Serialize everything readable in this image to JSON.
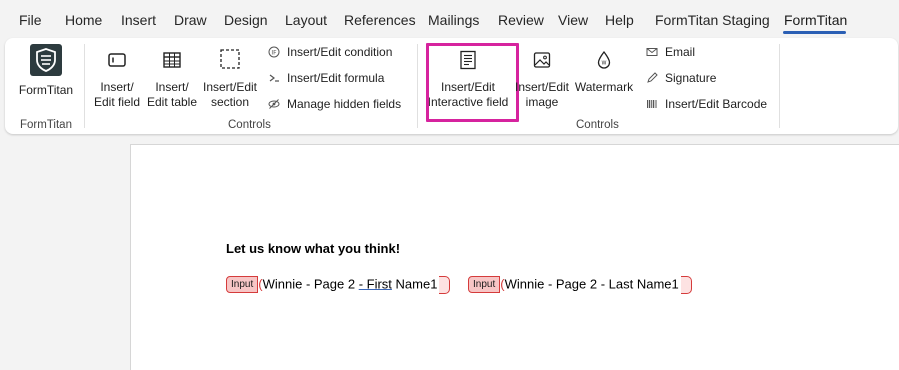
{
  "menu": {
    "items": [
      "File",
      "Home",
      "Insert",
      "Draw",
      "Design",
      "Layout",
      "References",
      "Mailings",
      "Review",
      "View",
      "Help",
      "FormTitan Staging",
      "FormTitan"
    ],
    "active": "FormTitan"
  },
  "ribbon": {
    "formtitan_group": {
      "button_label": "FormTitan",
      "group_label": "FormTitan"
    },
    "controls_group_1": {
      "edit_field": [
        "Insert/",
        "Edit field"
      ],
      "edit_table": [
        "Insert/",
        "Edit table"
      ],
      "edit_section": [
        "Insert/Edit",
        "section"
      ],
      "condition": "Insert/Edit condition",
      "formula": "Insert/Edit formula",
      "hidden": "Manage hidden fields",
      "group_label": "Controls"
    },
    "controls_group_2": {
      "interactive": [
        "Insert/Edit",
        "Interactive field"
      ],
      "image": [
        "Insert/Edit",
        "image"
      ],
      "watermark": "Watermark",
      "email": "Email",
      "signature": "Signature",
      "barcode": "Insert/Edit Barcode",
      "group_label": "Controls"
    }
  },
  "document": {
    "heading": "Let us know what you think!",
    "fields": [
      {
        "tag": "Input",
        "text_before": "Winnie - Page 2 ",
        "text_under": "-  First",
        "text_after": " Name1"
      },
      {
        "tag": "Input",
        "text": "Winnie - Page 2 -  Last Name1"
      }
    ]
  },
  "colors": {
    "highlight": "#d6239e",
    "tag_fill": "#f7c6c6",
    "tag_border": "#d53b3b",
    "accent": "#2b5fb4"
  }
}
